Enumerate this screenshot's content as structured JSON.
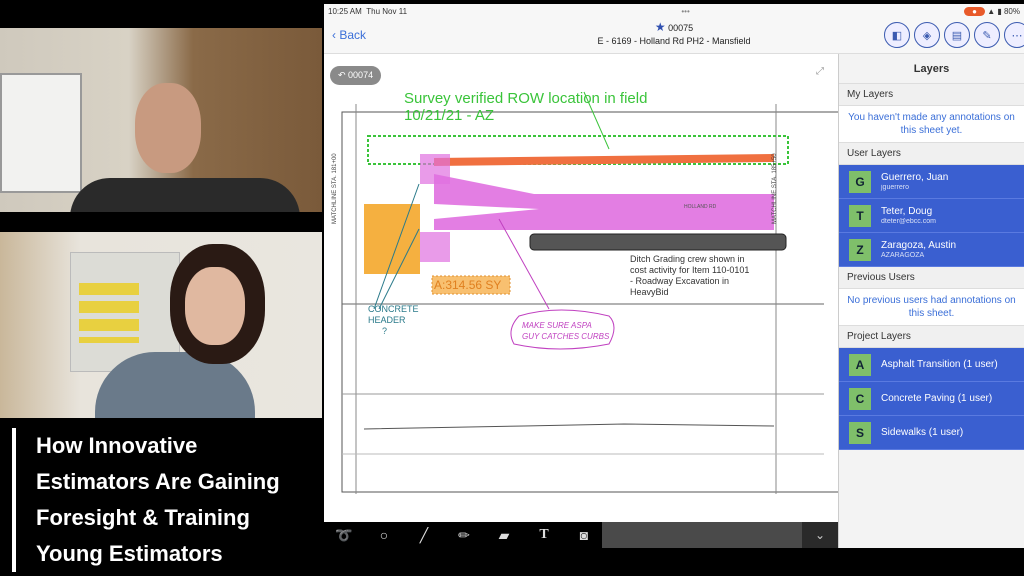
{
  "video_title": [
    "How Innovative",
    "Estimators Are Gaining",
    "Foresight & Training",
    "Young Estimators"
  ],
  "status": {
    "time": "10:25 AM",
    "date": "Thu Nov 11",
    "battery": "80%"
  },
  "nav": {
    "back": "Back",
    "sheet_number": "00075",
    "sheet_name": "E - 6169 - Holland Rd PH2 - Mansfield"
  },
  "sheet": {
    "prev_sheet": "00074",
    "annotations": {
      "survey": "Survey verified ROW location in field",
      "survey_date": "10/21/21 - AZ",
      "area": "A:314.56 SY",
      "ditch": [
        "Ditch Grading crew shown in",
        "cost activity for Item 110-0101",
        "- Roadway Excavation in",
        "HeavyBid"
      ],
      "concrete": [
        "CONCRETE",
        "HEADER",
        "?"
      ],
      "asphalt": [
        "MAKE SURE ASPA",
        "GUY CATCHES CURBS"
      ]
    },
    "labels": {
      "matchline_left": "MATCHLINE STA. 181+00",
      "matchline_right": "MATCHLINE STA. 185+50",
      "road": "HOLLAND RD"
    }
  },
  "layers": {
    "title": "Layers",
    "my_layers": "My Layers",
    "my_msg": "You haven't made any annotations on this sheet yet.",
    "user_layers": "User Layers",
    "users": [
      {
        "initial": "G",
        "name": "Guerrero, Juan",
        "sub": "jguerrero"
      },
      {
        "initial": "T",
        "name": "Teter, Doug",
        "sub": "dteter@ebcc.com"
      },
      {
        "initial": "Z",
        "name": "Zaragoza, Austin",
        "sub": "AZARAGOZA"
      }
    ],
    "previous_users": "Previous Users",
    "prev_msg": "No previous users had annotations on this sheet.",
    "project_layers": "Project Layers",
    "projects": [
      {
        "initial": "A",
        "name": "Asphalt Transition (1 user)"
      },
      {
        "initial": "C",
        "name": "Concrete Paving (1 user)"
      },
      {
        "initial": "S",
        "name": "Sidewalks (1 user)"
      }
    ]
  },
  "toolbar": [
    "lasso-icon",
    "circle-icon",
    "line-icon",
    "pencil-icon",
    "highlighter-icon",
    "text-icon",
    "camera-icon"
  ],
  "colors": {
    "layer_blue": "#3a5fd0",
    "avatar_green": "#7fbf6a",
    "annotation_green": "#3ac43a",
    "annotation_pink": "#e070e0"
  }
}
